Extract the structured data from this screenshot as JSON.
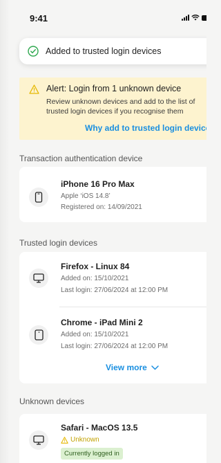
{
  "status_bar": {
    "time": "9:41"
  },
  "toast": {
    "message": "Added to trusted login devices"
  },
  "alert": {
    "title": "Alert: Login from 1 unknown device",
    "body": "Review unknown devices and add to the list of trusted login devices if you recognise them",
    "link": "Why add to trusted login devices?"
  },
  "transaction_section": {
    "heading": "Transaction authentication device",
    "device": {
      "name": "iPhone 16 Pro Max",
      "line1": "Apple ‘iOS 14.8’",
      "line2": "Registered on: 14/09/2021",
      "icon": "phone-icon"
    }
  },
  "trusted_section": {
    "heading": "Trusted login devices",
    "devices": [
      {
        "name": "Firefox - Linux 84",
        "line1": "Added on: 15/10/2021",
        "line2": "Last login: 27/06/2024 at 12:00 PM",
        "icon": "monitor-icon",
        "more": "···"
      },
      {
        "name": "Chrome - iPad Mini 2",
        "line1": "Added on: 15/10/2021",
        "line2": "Last login: 27/06/2024 at 12:00 PM",
        "icon": "tablet-icon",
        "more": "···"
      }
    ],
    "view_more": "View more"
  },
  "unknown_section": {
    "heading": "Unknown devices",
    "devices": [
      {
        "name": "Safari - MacOS 13.5",
        "status": "Unknown",
        "badge": "Currently logged in",
        "icon": "monitor-icon",
        "more": "···"
      }
    ]
  },
  "colors": {
    "accent": "#1a8fe0",
    "alert_bg": "#fdf3cf",
    "success": "#2fa84f",
    "warning": "#e6b800",
    "badge_bg": "#dbf0d0"
  }
}
